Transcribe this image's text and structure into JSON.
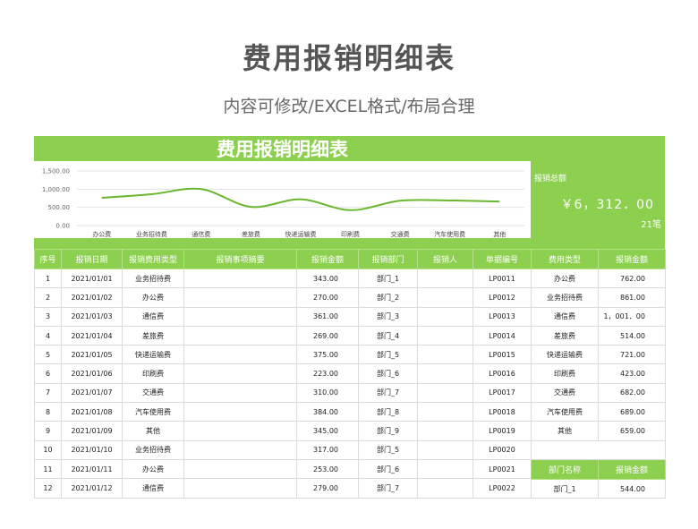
{
  "page": {
    "title": "费用报销明细表",
    "subtitle": "内容可修改/EXCEL格式/布局合理"
  },
  "sheet": {
    "title": "费用报销明细表",
    "total_label": "报销总额",
    "total_amount": "￥6，312．00",
    "total_count": "21笔"
  },
  "colors": {
    "accent": "#8dd04f",
    "line": "#6ab72f"
  },
  "chart_data": {
    "type": "line",
    "categories": [
      "办公费",
      "业务招待费",
      "通信费",
      "差旅费",
      "快递运输费",
      "印刷费",
      "交通费",
      "汽车使用费",
      "其他"
    ],
    "y_tick_labels": [
      "1,500.00",
      "1,000.00",
      "500.00",
      "0.00"
    ],
    "series": [
      {
        "values": [
          762,
          861,
          1001,
          514,
          721,
          423,
          682,
          689,
          659
        ]
      }
    ],
    "ylim": [
      0,
      1500
    ],
    "grid": true,
    "smooth": true
  },
  "table": {
    "headers": [
      "序号",
      "报销日期",
      "报销费用类型",
      "报销事项摘要",
      "报销金额",
      "报销部门",
      "报销人",
      "单据编号"
    ],
    "rows": [
      [
        "1",
        "2021/01/01",
        "业务招待费",
        "",
        "343.00",
        "部门_1",
        "",
        "LP0011"
      ],
      [
        "2",
        "2021/01/02",
        "办公费",
        "",
        "270.00",
        "部门_2",
        "",
        "LP0012"
      ],
      [
        "3",
        "2021/01/03",
        "通信费",
        "",
        "361.00",
        "部门_3",
        "",
        "LP0013"
      ],
      [
        "4",
        "2021/01/04",
        "差旅费",
        "",
        "269.00",
        "部门_4",
        "",
        "LP0014"
      ],
      [
        "5",
        "2021/01/05",
        "快递运输费",
        "",
        "375.00",
        "部门_5",
        "",
        "LP0015"
      ],
      [
        "6",
        "2021/01/06",
        "印刷费",
        "",
        "223.00",
        "部门_6",
        "",
        "LP0016"
      ],
      [
        "7",
        "2021/01/07",
        "交通费",
        "",
        "310.00",
        "部门_7",
        "",
        "LP0017"
      ],
      [
        "8",
        "2021/01/08",
        "汽车使用费",
        "",
        "384.00",
        "部门_8",
        "",
        "LP0018"
      ],
      [
        "9",
        "2021/01/09",
        "其他",
        "",
        "345.00",
        "部门_9",
        "",
        "LP0019"
      ],
      [
        "10",
        "2021/01/10",
        "业务招待费",
        "",
        "317.00",
        "部门_5",
        "",
        "LP0020"
      ],
      [
        "11",
        "2021/01/11",
        "办公费",
        "",
        "253.00",
        "部门_6",
        "",
        "LP0021"
      ],
      [
        "12",
        "2021/01/12",
        "通信费",
        "",
        "279.00",
        "部门_7",
        "",
        "LP0022"
      ]
    ]
  },
  "summary_by_type": {
    "headers": [
      "费用类型",
      "报销金额"
    ],
    "rows": [
      [
        "办公费",
        "762.00"
      ],
      [
        "业务招待费",
        "861.00"
      ],
      [
        "通信费",
        "1，001．00"
      ],
      [
        "差旅费",
        "514.00"
      ],
      [
        "快递运输费",
        "721.00"
      ],
      [
        "印刷费",
        "423.00"
      ],
      [
        "交通费",
        "682.00"
      ],
      [
        "汽车使用费",
        "689.00"
      ],
      [
        "其他",
        "659.00"
      ]
    ]
  },
  "summary_by_dept": {
    "headers": [
      "部门名称",
      "报销金额"
    ],
    "rows": [
      [
        "部门_1",
        "544.00"
      ]
    ]
  }
}
